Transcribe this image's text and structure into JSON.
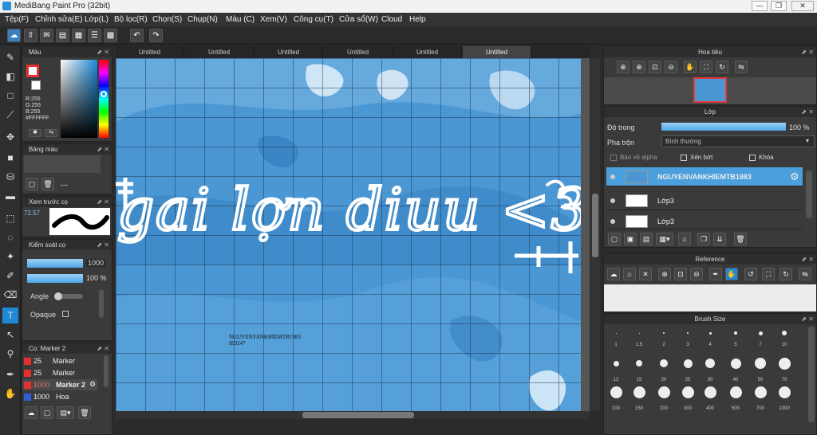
{
  "app": {
    "title": "MediBang Paint Pro (32bit)"
  },
  "menu": [
    "Tệp(F)",
    "Chỉnh sửa(E)",
    "Lớp(L)",
    "Bộ lọc(R)",
    "Chọn(S)",
    "Chụp(N)",
    "Màu (C)",
    "Xem(V)",
    "Công cụ(T)",
    "Cửa sổ(W)",
    "Cloud",
    "Help"
  ],
  "tabs": [
    "Untitled",
    "Untitled",
    "Untitled",
    "Untitled",
    "Untitled",
    "Untitled"
  ],
  "color_panel": {
    "title": "Màu",
    "r": "R:255",
    "g": "G:255",
    "b": "B:255",
    "hex": "#FFFFFF",
    "primary": "#e53030",
    "secondary": "#ffffff"
  },
  "palette_panel": {
    "title": "Bảng màu",
    "dash": "---"
  },
  "preview_panel": {
    "title": "Xem trước cọ",
    "zoom": "72.57"
  },
  "brush_control": {
    "title": "Kiểm soát cọ",
    "size": "1000",
    "opacity": "100 %",
    "angle_label": "Angle",
    "opaque_label": "Opaque"
  },
  "brush_list": {
    "title": "Cọ: Marker 2",
    "items": [
      {
        "num": "25",
        "name": "Marker",
        "color": "#e53030"
      },
      {
        "num": "25",
        "name": "Marker",
        "color": "#e53030"
      },
      {
        "num": "1000",
        "name": "Marker 2",
        "color": "#e53030"
      },
      {
        "num": "1000",
        "name": "Hoa",
        "color": "#2f5fd8"
      }
    ]
  },
  "navigator": {
    "title": "Hoa tiêu"
  },
  "layer_panel": {
    "title": "Lớp",
    "opacity_label": "Độ trong",
    "opacity_value": "100 %",
    "blend_label": "Pha trộn",
    "blend_value": "Bình thường",
    "protect_alpha": "Bảo vệ alpha",
    "clipping": "Xén bớt",
    "lock": "Khóa",
    "layers": [
      {
        "name": "NGUYENVANKHIEMTB1983"
      },
      {
        "name": "Lớp3"
      },
      {
        "name": "Lớp3"
      }
    ]
  },
  "reference_panel": {
    "title": "Reference"
  },
  "brush_size_panel": {
    "title": "Brush Size",
    "sizes": [
      "1",
      "1.5",
      "2",
      "3",
      "4",
      "5",
      "7",
      "10",
      "12",
      "15",
      "20",
      "25",
      "30",
      "40",
      "50",
      "70",
      "100",
      "150",
      "200",
      "300",
      "400",
      "500",
      "700",
      "1000"
    ]
  },
  "artwork": {
    "main_text": "gai lợn diuu <3",
    "watermark_line1": "NGUYENVANKHIEMTB1983",
    "watermark_line2": "HD247"
  }
}
